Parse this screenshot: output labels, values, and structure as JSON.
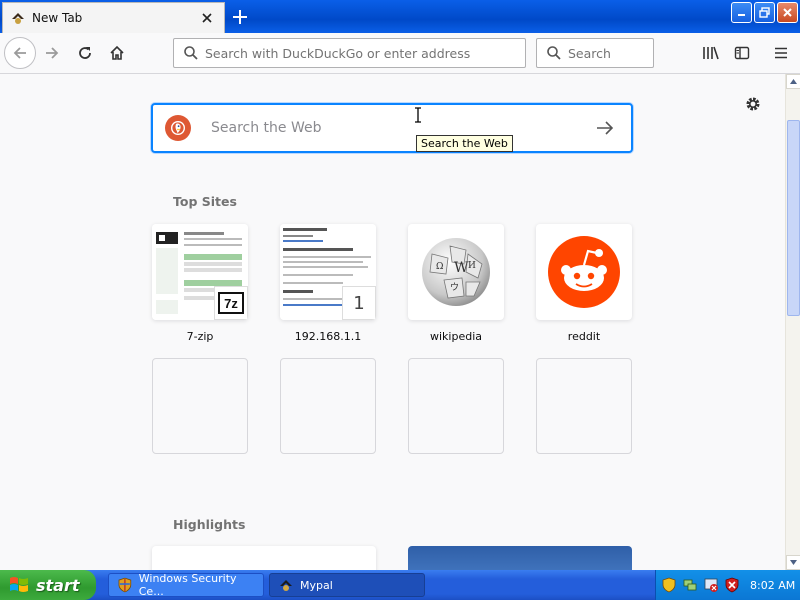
{
  "window": {
    "tab_title": "New Tab",
    "new_tab_symbol": "+",
    "controls": [
      "minimize-icon",
      "restore-icon",
      "close-icon"
    ]
  },
  "navbar": {
    "url_placeholder": "Search with DuckDuckGo or enter address",
    "search_placeholder": "Search"
  },
  "newtab": {
    "search_placeholder": "Search the Web",
    "search_tooltip": "Search the Web",
    "top_sites_title": "Top Sites",
    "highlights_title": "Highlights",
    "top_sites": [
      {
        "label": "7-zip",
        "icon": "7zip-thumbnail"
      },
      {
        "label": "192.168.1.1",
        "icon": "router-thumbnail",
        "badge": "1"
      },
      {
        "label": "wikipedia",
        "icon": "wikipedia-logo"
      },
      {
        "label": "reddit",
        "icon": "reddit-logo"
      }
    ]
  },
  "taskbar": {
    "start_label": "start",
    "tasks": [
      {
        "label": "Windows Security Ce..."
      },
      {
        "label": "Mypal"
      }
    ],
    "clock": "8:02 AM"
  },
  "colors": {
    "accent": "#0a84ff",
    "reddit": "#ff4500",
    "ddg": "#de5833",
    "xp_taskbar": "#245edb",
    "xp_start": "#3daa3d"
  }
}
